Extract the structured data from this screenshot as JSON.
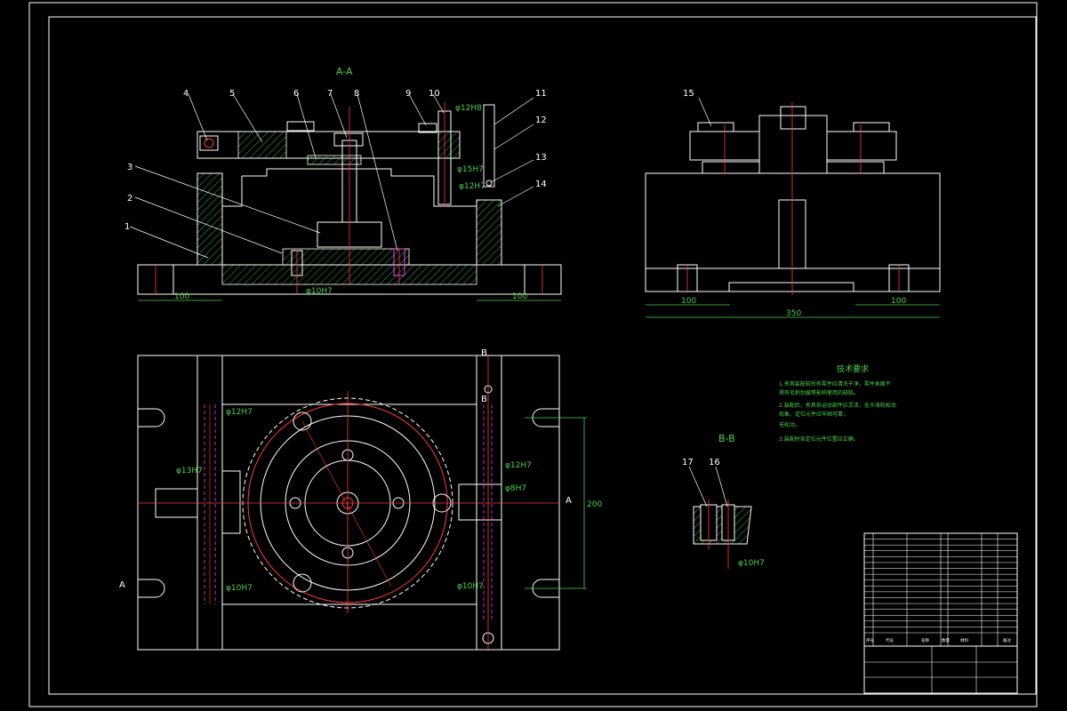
{
  "views": {
    "section_aa": "A-A",
    "section_bb": "B-B",
    "section_b_marker_top": "B",
    "section_b_marker_bottom": "B",
    "section_a_marker_left": "A",
    "section_a_marker_right": "A"
  },
  "part_numbers": [
    "1",
    "2",
    "3",
    "4",
    "5",
    "6",
    "7",
    "8",
    "9",
    "10",
    "11",
    "12",
    "13",
    "14",
    "15",
    "16",
    "17"
  ],
  "dimensions": {
    "front_left_width": "100",
    "front_right_width": "100",
    "side_left_width": "100",
    "side_right_width": "100",
    "side_total_width": "350",
    "plan_height": "200",
    "bore_front": "φ10H7",
    "bore_top_right": "φ12H8",
    "bore_front_mid": "φ15H7",
    "bore_front_low": "φ12H7",
    "plan_dia_1": "φ12H7",
    "plan_dia_2": "φ13H7",
    "plan_dia_3": "φ10H7",
    "plan_dia_4": "φ12H7",
    "plan_dia_5": "φ8H7",
    "plan_dia_6": "φ10H7",
    "bb_dia": "φ10H7"
  },
  "notes": {
    "title": "技术要求",
    "lines": [
      "1.夹具装配前所有零件应清洗干净，零件表面不",
      "  得有毛刺划痕等影响使用的缺陷。",
      "2.装配后，夹具各运动部件应灵活，无卡滞和松动",
      "  现象，定位元件应牢固可靠，",
      "  无松动。",
      "3.装配时各定位元件位置应正确。"
    ]
  },
  "title_block": {
    "rows": 17,
    "header_cells": [
      "序号",
      "代号",
      "名称",
      "数量",
      "材料",
      "备注"
    ]
  },
  "colors": {
    "line": "#ffffff",
    "center": "#ff3b3b",
    "dimension": "#4fd04f",
    "hidden": "#ff3bff",
    "hatch": "#4fd04f"
  }
}
